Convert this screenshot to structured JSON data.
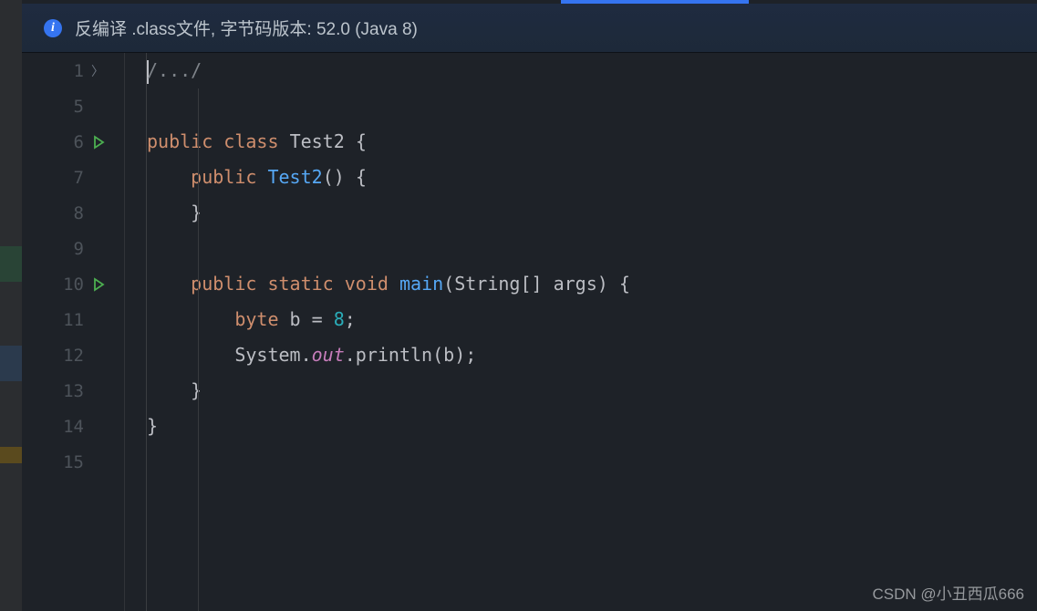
{
  "infoBar": {
    "icon": "i",
    "text": "反编译 .class文件, 字节码版本: 52.0 (Java 8)"
  },
  "lineNumbers": [
    "1",
    "5",
    "6",
    "7",
    "8",
    "9",
    "10",
    "11",
    "12",
    "13",
    "14",
    "15"
  ],
  "code": {
    "folded": "/.../",
    "kw_public": "public",
    "kw_class": "class",
    "cls_name": "Test2",
    "brace_open": "{",
    "brace_close": "}",
    "ctor_name": "Test2",
    "parens": "()",
    "kw_static": "static",
    "kw_void": "void",
    "m_main": "main",
    "main_args_open": "(",
    "main_args_type": "String[]",
    "main_args_name": "args",
    "main_args_close": ")",
    "kw_byte": "byte",
    "var_b": "b",
    "eq": "=",
    "num_8": "8",
    "semi": ";",
    "sys": "System",
    "dot": ".",
    "out": "out",
    "println": "println",
    "paren_open": "(",
    "arg_b": "b",
    "paren_close": ")"
  },
  "watermark": "CSDN @小丑西瓜666"
}
